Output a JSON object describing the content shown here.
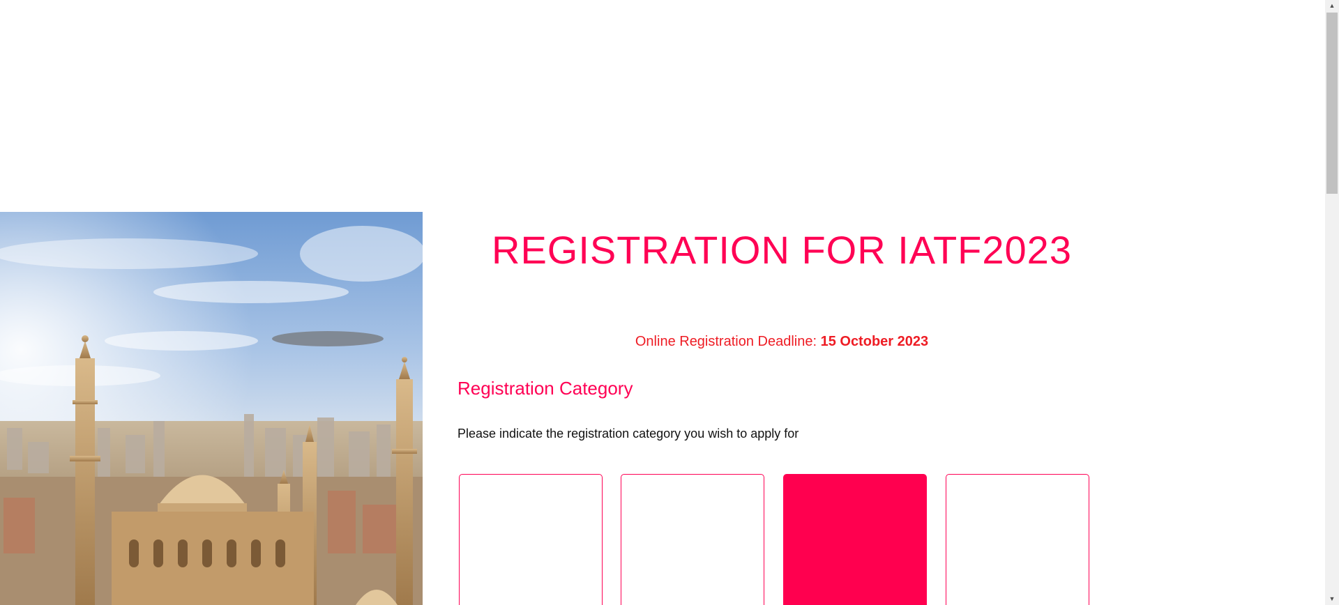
{
  "page": {
    "title": "REGISTRATION FOR IATF2023",
    "deadline_label": "Online Registration Deadline: ",
    "deadline_date": "15 October 2023",
    "section_title": "Registration Category",
    "instruction": "Please indicate the registration category you wish to apply for"
  },
  "hero": {
    "image_subject": "Cairo skyline with mosque domes and minarets"
  },
  "categories": [
    {
      "selected": false
    },
    {
      "selected": false
    },
    {
      "selected": true
    },
    {
      "selected": false
    }
  ],
  "colors": {
    "accent": "#ff0054",
    "deadline_text": "#ee1c24",
    "selected_card": "#ff004f",
    "body_text": "#111111"
  },
  "scrollbar": {
    "up_icon": "scroll-up-arrow-icon",
    "down_icon": "scroll-down-arrow-icon"
  }
}
